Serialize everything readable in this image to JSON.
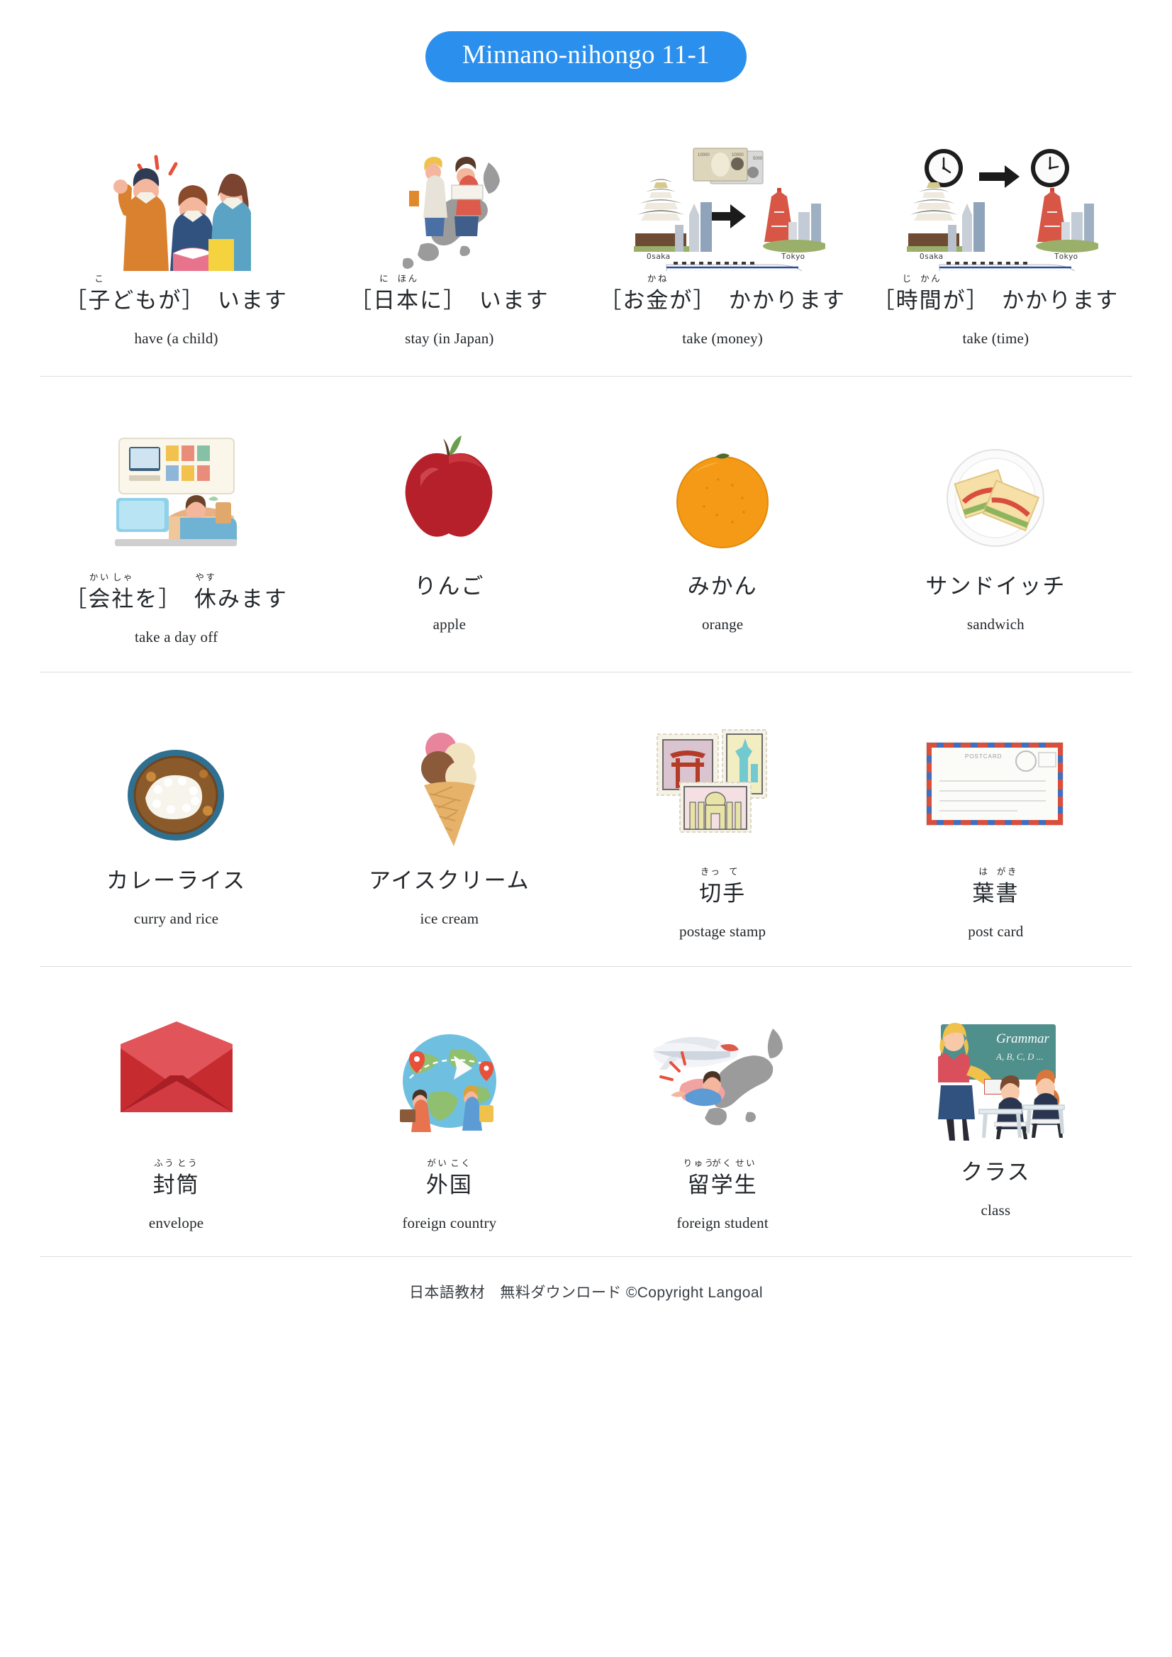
{
  "header": {
    "title": "Minnano-nihongo 11-1",
    "accent_color": "#2b90ed"
  },
  "footer": {
    "text": "日本語教材　無料ダウンロード ©Copyright Langoal"
  },
  "rows": [
    {
      "items": [
        {
          "icon": "family-illustration",
          "jp_parts": [
            {
              "text": "［"
            },
            {
              "text": "子",
              "ruby": "こ"
            },
            {
              "text": "どもが］　います"
            }
          ],
          "jp_plain": "［子どもが］　います",
          "en": "have (a child)"
        },
        {
          "icon": "japan-map-travelers-illustration",
          "jp_parts": [
            {
              "text": "［"
            },
            {
              "text": "日",
              "ruby": "に"
            },
            {
              "text": "本",
              "ruby": "ほん"
            },
            {
              "text": "に］　います"
            }
          ],
          "jp_plain": "［日本に］　います",
          "en": "stay (in Japan)"
        },
        {
          "icon": "money-osaka-tokyo-shinkansen-illustration",
          "jp_parts": [
            {
              "text": "［お"
            },
            {
              "text": "金",
              "ruby": "かね"
            },
            {
              "text": "が］　かかります"
            }
          ],
          "jp_plain": "［お金が］　かかります",
          "en": "take (money)"
        },
        {
          "icon": "clock-osaka-tokyo-shinkansen-illustration",
          "jp_parts": [
            {
              "text": "［"
            },
            {
              "text": "時",
              "ruby": "じ"
            },
            {
              "text": "間",
              "ruby": "かん"
            },
            {
              "text": "が］　かかります"
            }
          ],
          "jp_plain": "［時間が］　かかります",
          "en": "take (time)"
        }
      ]
    },
    {
      "items": [
        {
          "icon": "day-off-sleeping-illustration",
          "jp_parts": [
            {
              "text": "［"
            },
            {
              "text": "会",
              "ruby": "かい"
            },
            {
              "text": "社",
              "ruby": "しゃ"
            },
            {
              "text": "を］　"
            },
            {
              "text": "休",
              "ruby": "やす"
            },
            {
              "text": "みます"
            }
          ],
          "jp_plain": "［会社を］　休みます",
          "en": "take a day off",
          "lower": true
        },
        {
          "icon": "apple-illustration",
          "jp_parts": [
            {
              "text": "りんご"
            }
          ],
          "jp_plain": "りんご",
          "en": "apple"
        },
        {
          "icon": "orange-illustration",
          "jp_parts": [
            {
              "text": "みかん"
            }
          ],
          "jp_plain": "みかん",
          "en": "orange"
        },
        {
          "icon": "sandwich-illustration",
          "jp_parts": [
            {
              "text": "サンドイッチ"
            }
          ],
          "jp_plain": "サンドイッチ",
          "en": "sandwich"
        }
      ]
    },
    {
      "items": [
        {
          "icon": "curry-rice-illustration",
          "jp_parts": [
            {
              "text": "カレーライス"
            }
          ],
          "jp_plain": "カレーライス",
          "en": "curry and rice"
        },
        {
          "icon": "ice-cream-illustration",
          "jp_parts": [
            {
              "text": "アイスクリーム"
            }
          ],
          "jp_plain": "アイスクリーム",
          "en": "ice cream"
        },
        {
          "icon": "postage-stamps-illustration",
          "jp_parts": [
            {
              "text": "切",
              "ruby": "きっ"
            },
            {
              "text": "手",
              "ruby": "て"
            }
          ],
          "jp_plain": "切手",
          "en": "postage stamp",
          "lower": true
        },
        {
          "icon": "post-card-illustration",
          "jp_parts": [
            {
              "text": "葉",
              "ruby": "は"
            },
            {
              "text": "書",
              "ruby": "がき"
            }
          ],
          "jp_plain": "葉書",
          "en": "post card",
          "lower": true
        }
      ]
    },
    {
      "items": [
        {
          "icon": "envelope-illustration",
          "jp_parts": [
            {
              "text": "封",
              "ruby": "ふう"
            },
            {
              "text": "筒",
              "ruby": "とう"
            }
          ],
          "jp_plain": "封筒",
          "en": "envelope",
          "lower": true
        },
        {
          "icon": "globe-travel-illustration",
          "jp_parts": [
            {
              "text": "外",
              "ruby": "がい"
            },
            {
              "text": "国",
              "ruby": "こく"
            }
          ],
          "jp_plain": "外国",
          "en": "foreign country",
          "lower": true
        },
        {
          "icon": "foreign-student-airplane-illustration",
          "jp_parts": [
            {
              "text": "留",
              "ruby": "りゅう"
            },
            {
              "text": "学",
              "ruby": "がく"
            },
            {
              "text": "生",
              "ruby": "せい"
            }
          ],
          "jp_plain": "留学生",
          "en": "foreign student",
          "lower": true
        },
        {
          "icon": "classroom-illustration",
          "jp_parts": [
            {
              "text": "クラス"
            }
          ],
          "jp_plain": "クラス",
          "en": "class"
        }
      ]
    }
  ],
  "illustration_labels": {
    "osaka": "Osaka",
    "tokyo": "Tokyo",
    "banknote_10000": "10000",
    "banknote_5000": "5000",
    "postcard": "POSTCARD",
    "blackboard_title": "Grammar",
    "blackboard_sub": "A, B, C, D ..."
  }
}
